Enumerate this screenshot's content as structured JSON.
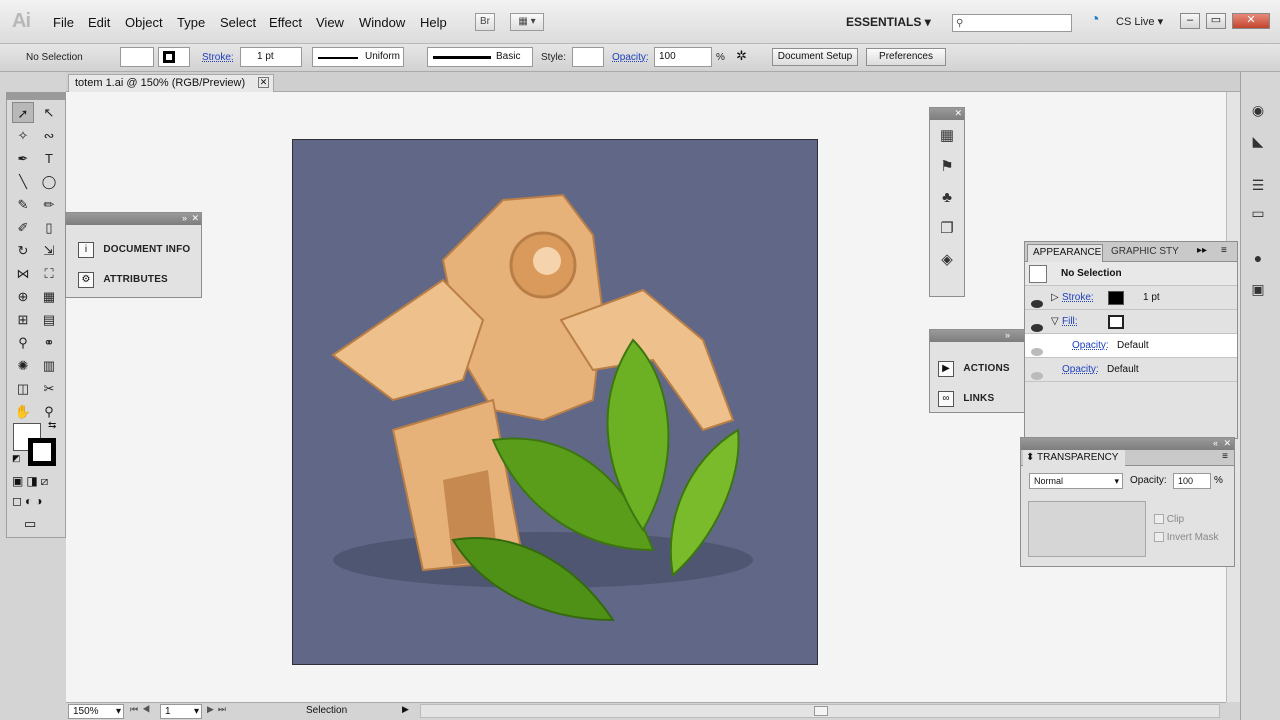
{
  "app": {
    "logo": "Ai"
  },
  "menu": [
    "File",
    "Edit",
    "Object",
    "Type",
    "Select",
    "Effect",
    "View",
    "Window",
    "Help"
  ],
  "topbar": {
    "bridge": "Br",
    "workspace": "ESSENTIALS",
    "cs_live": "CS Live"
  },
  "control": {
    "selection": "No Selection",
    "stroke_label": "Stroke:",
    "stroke_value": "1 pt",
    "profile": "Uniform",
    "brush": "Basic",
    "style_label": "Style:",
    "opacity_label": "Opacity:",
    "opacity_value": "100",
    "opacity_unit": "%",
    "document_setup": "Document Setup",
    "preferences": "Preferences"
  },
  "document": {
    "tab_title": "totem 1.ai @ 150% (RGB/Preview)"
  },
  "panel_docinfo": {
    "items": [
      "DOCUMENT INFO",
      "ATTRIBUTES"
    ]
  },
  "panel_actions": {
    "items": [
      "ACTIONS",
      "LINKS"
    ]
  },
  "appearance": {
    "tab": "APPEARANCE",
    "tab2": "GRAPHIC STY",
    "title": "No Selection",
    "stroke_label": "Stroke:",
    "stroke_value": "1 pt",
    "fill_label": "Fill:",
    "fill_opacity_label": "Opacity:",
    "fill_opacity_value": "Default",
    "opacity_label": "Opacity:",
    "opacity_value": "Default"
  },
  "transparency": {
    "title": "TRANSPARENCY",
    "mode": "Normal",
    "opacity_label": "Opacity:",
    "opacity_value": "100",
    "unit": "%",
    "clip": "Clip",
    "invert": "Invert Mask"
  },
  "status": {
    "zoom": "150%",
    "artboard": "1",
    "tool": "Selection"
  },
  "colors": {
    "artboard_bg": "#616887",
    "leaf": "#5a9d1b",
    "wood": "#e7b27a"
  }
}
